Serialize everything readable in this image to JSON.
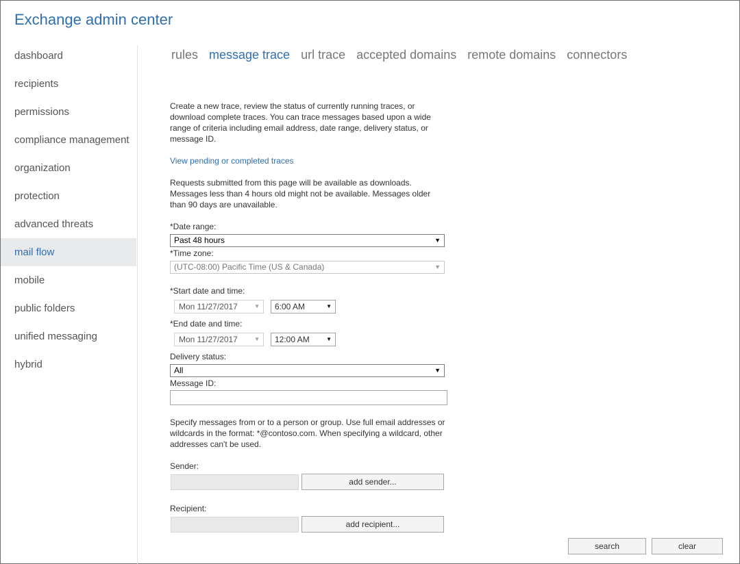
{
  "app": {
    "title": "Exchange admin center"
  },
  "sidebar": {
    "items": [
      {
        "label": "dashboard"
      },
      {
        "label": "recipients"
      },
      {
        "label": "permissions"
      },
      {
        "label": "compliance management"
      },
      {
        "label": "organization"
      },
      {
        "label": "protection"
      },
      {
        "label": "advanced threats"
      },
      {
        "label": "mail flow",
        "active": true
      },
      {
        "label": "mobile"
      },
      {
        "label": "public folders"
      },
      {
        "label": "unified messaging"
      },
      {
        "label": "hybrid"
      }
    ]
  },
  "tabs": [
    {
      "label": "rules"
    },
    {
      "label": "message trace",
      "active": true
    },
    {
      "label": "url trace"
    },
    {
      "label": "accepted domains"
    },
    {
      "label": "remote domains"
    },
    {
      "label": "connectors"
    }
  ],
  "main": {
    "intro": "Create a new trace, review the status of currently running traces, or download complete traces. You can trace messages based upon a wide range of criteria including email address, date range, delivery status, or message ID.",
    "view_link": "View pending or completed traces",
    "note": "Requests submitted from this page will be available as downloads. Messages less than 4 hours old might not be available. Messages older than 90 days are unavailable.",
    "date_range": {
      "label": "*Date range:",
      "value": "Past 48 hours"
    },
    "time_zone": {
      "label": "*Time zone:",
      "value": "(UTC-08:00) Pacific Time (US & Canada)"
    },
    "start": {
      "label": "*Start date and time:",
      "date": "Mon 11/27/2017",
      "time": "6:00 AM"
    },
    "end": {
      "label": "*End date and time:",
      "date": "Mon 11/27/2017",
      "time": "12:00 AM"
    },
    "delivery_status": {
      "label": "Delivery status:",
      "value": "All"
    },
    "message_id": {
      "label": "Message ID:",
      "value": ""
    },
    "specify_text": "Specify messages from or to a person or group. Use full email addresses or wildcards in the format: *@contoso.com. When specifying a wildcard, other addresses can't be used.",
    "sender": {
      "label": "Sender:",
      "button": "add sender..."
    },
    "recipient": {
      "label": "Recipient:",
      "button": "add recipient..."
    },
    "search_button": "search",
    "clear_button": "clear"
  },
  "icons": {
    "dropdown": "▼"
  }
}
